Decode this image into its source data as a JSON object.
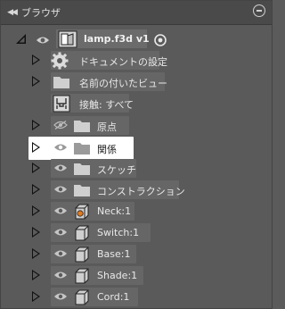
{
  "panel": {
    "title": "ブラウザ",
    "collapse_icon": "double-chevron-left-icon",
    "close_icon": "minus-circle-icon"
  },
  "root": {
    "label": "lamp.f3d v1",
    "icon": "component-icon"
  },
  "items": [
    {
      "label": "ドキュメントの設定",
      "icon": "gear-icon",
      "eye": false,
      "expander": true
    },
    {
      "label": "名前の付いたビュー",
      "icon": "folder-icon",
      "eye": false,
      "expander": true
    },
    {
      "label": "接触: すべて",
      "icon": "contact-icon",
      "eye": false,
      "expander": false
    },
    {
      "label": "原点",
      "icon": "folder-icon",
      "eye": true,
      "eye_hidden": true,
      "expander": true
    },
    {
      "label": "関係",
      "icon": "folder-icon",
      "eye": true,
      "expander": true,
      "highlight": true
    },
    {
      "label": "スケッチ",
      "icon": "folder-icon",
      "eye": true,
      "expander": true
    },
    {
      "label": "コンストラクション",
      "icon": "folder-icon",
      "eye": true,
      "expander": true
    },
    {
      "label": "Neck:1",
      "icon": "body-icon",
      "eye": true,
      "expander": true
    },
    {
      "label": "Switch:1",
      "icon": "body-icon",
      "eye": true,
      "expander": true
    },
    {
      "label": "Base:1",
      "icon": "body-icon",
      "eye": true,
      "expander": true
    },
    {
      "label": "Shade:1",
      "icon": "body-icon",
      "eye": true,
      "expander": true
    },
    {
      "label": "Cord:1",
      "icon": "body-icon",
      "eye": true,
      "expander": true
    }
  ]
}
